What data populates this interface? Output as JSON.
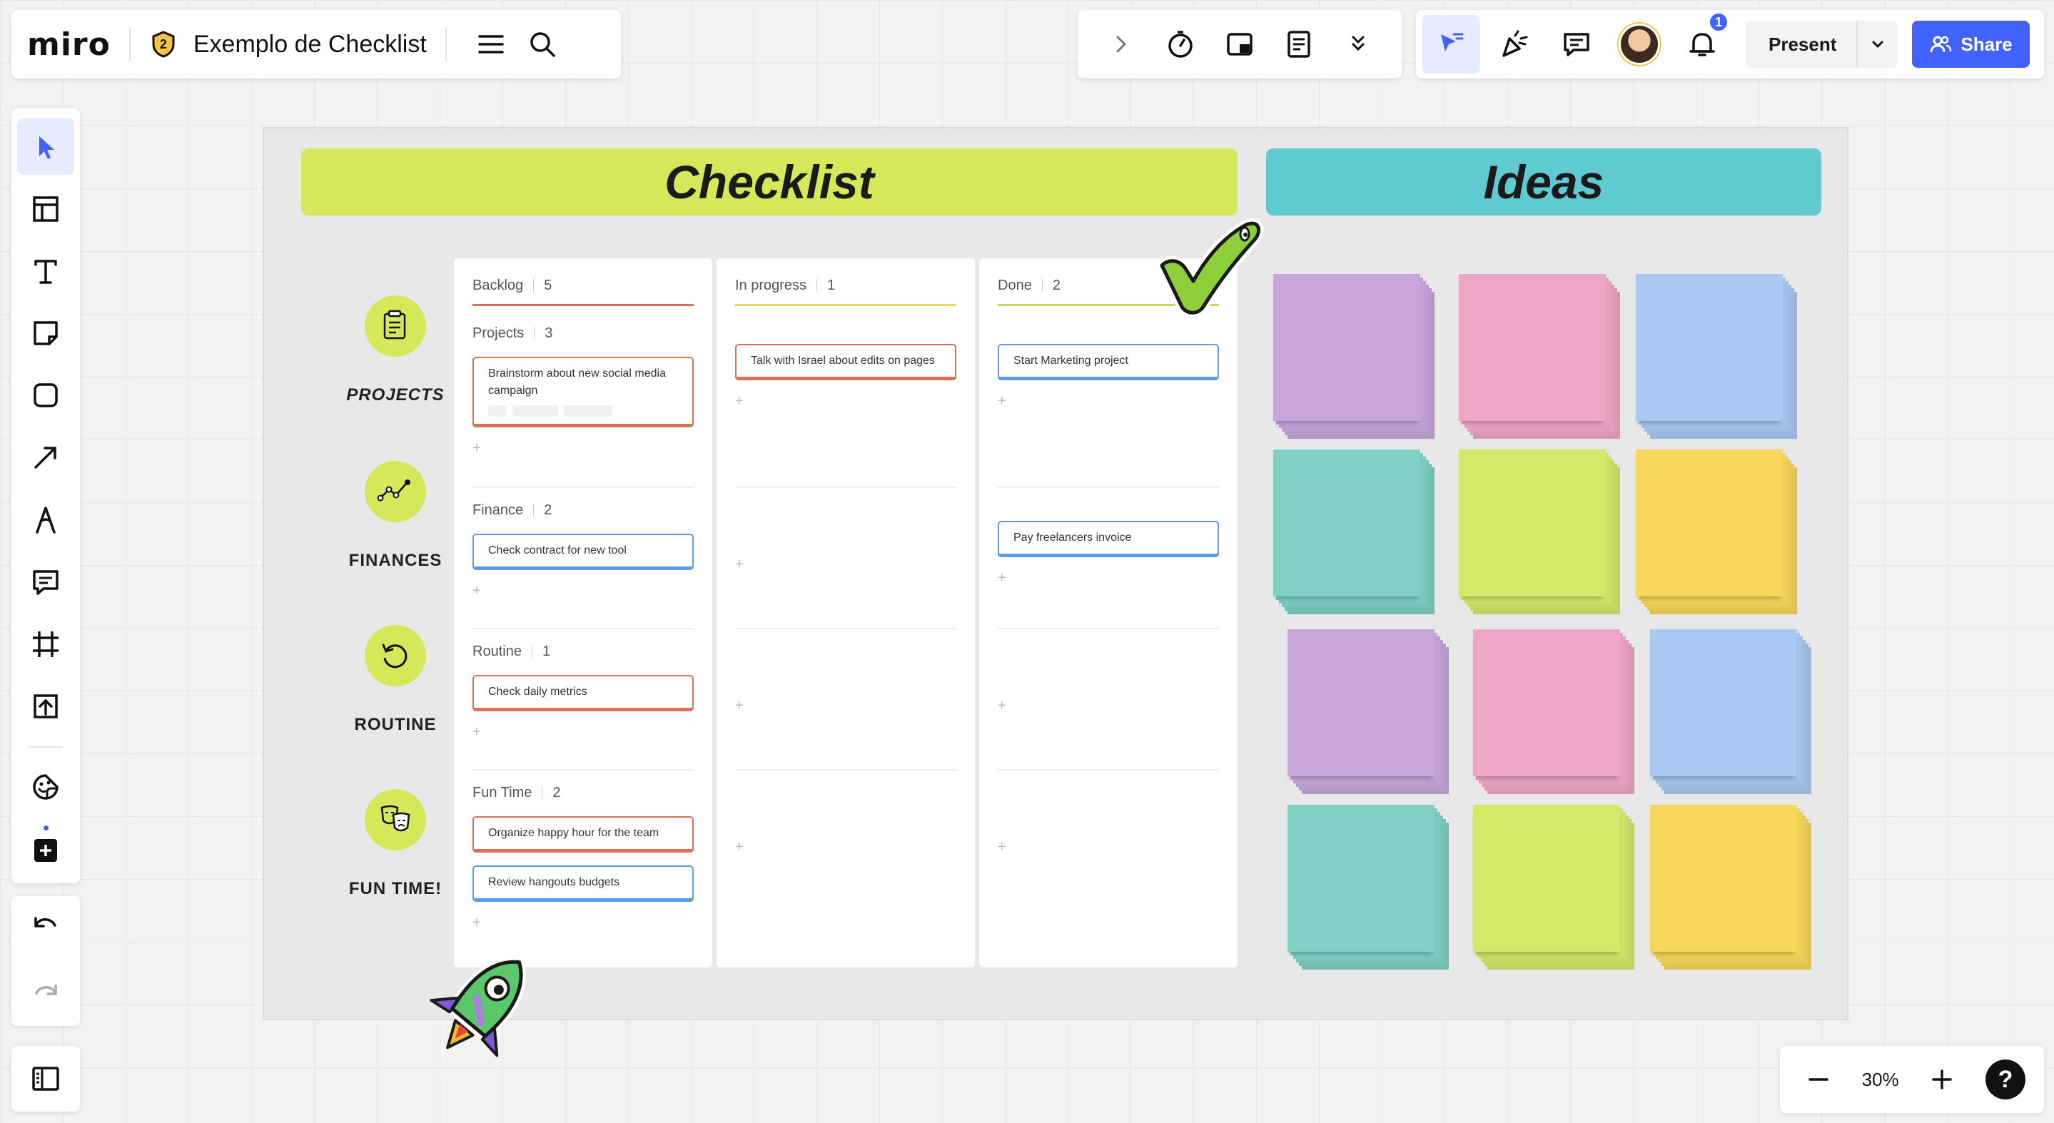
{
  "app": {
    "logo": "miro",
    "board_title": "Exemplo de Checklist",
    "plan_badge": "2"
  },
  "toolbar": {
    "present_label": "Present",
    "share_label": "Share",
    "notifications_count": "1"
  },
  "zoom": {
    "level": "30%"
  },
  "help_label": "?",
  "board": {
    "checklist_title": "Checklist",
    "ideas_title": "Ideas",
    "categories": [
      {
        "label": "PROJECTS",
        "icon": "clipboard-icon"
      },
      {
        "label": "FINANCES",
        "icon": "chart-line-icon"
      },
      {
        "label": "ROUTINE",
        "icon": "refresh-icon"
      },
      {
        "label": "FUN TIME!",
        "icon": "theater-masks-icon"
      }
    ],
    "columns": [
      {
        "title": "Backlog",
        "count": "5",
        "color": "#e06c5a"
      },
      {
        "title": "In progress",
        "count": "1",
        "color": "#f1d45a"
      },
      {
        "title": "Done",
        "count": "2",
        "color": "#c8d85a"
      }
    ],
    "groups": [
      {
        "title": "Projects",
        "count": "3"
      },
      {
        "title": "Finance",
        "count": "2"
      },
      {
        "title": "Routine",
        "count": "1"
      },
      {
        "title": "Fun Time",
        "count": "2"
      }
    ],
    "cards": {
      "backlog_projects": "Brainstorm about new social media campaign",
      "backlog_finance": "Check contract for new tool",
      "backlog_routine": "Check daily metrics",
      "backlog_fun_1": "Organize happy hour for the team",
      "backlog_fun_2": "Review hangouts budgets",
      "progress_projects": "Talk with Israel about edits on pages",
      "done_projects": "Start Marketing project",
      "done_finance": "Pay freelancers invoice"
    },
    "add_symbol": "+",
    "sticky_colors": [
      "#c7a6dc",
      "#eea6c6",
      "#a9c8f2",
      "#7fd1c6",
      "#d5e86a",
      "#f7d75a"
    ]
  }
}
